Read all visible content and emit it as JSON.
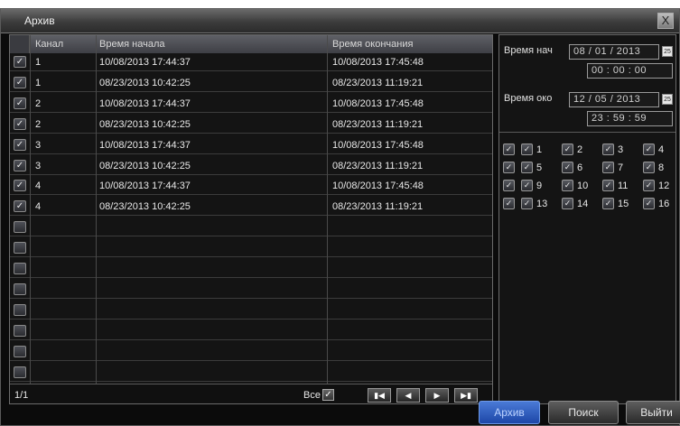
{
  "window": {
    "title": "Архив",
    "close_glyph": "X"
  },
  "table": {
    "headers": [
      "Канал",
      "Время начала",
      "Время окончания"
    ],
    "rows": [
      {
        "checked": true,
        "channel": "1",
        "start": "10/08/2013 17:44:37",
        "end": "10/08/2013 17:45:48"
      },
      {
        "checked": true,
        "channel": "1",
        "start": "08/23/2013 10:42:25",
        "end": "08/23/2013 11:19:21"
      },
      {
        "checked": true,
        "channel": "2",
        "start": "10/08/2013 17:44:37",
        "end": "10/08/2013 17:45:48"
      },
      {
        "checked": true,
        "channel": "2",
        "start": "08/23/2013 10:42:25",
        "end": "08/23/2013 11:19:21"
      },
      {
        "checked": true,
        "channel": "3",
        "start": "10/08/2013 17:44:37",
        "end": "10/08/2013 17:45:48"
      },
      {
        "checked": true,
        "channel": "3",
        "start": "08/23/2013 10:42:25",
        "end": "08/23/2013 11:19:21"
      },
      {
        "checked": true,
        "channel": "4",
        "start": "10/08/2013 17:44:37",
        "end": "10/08/2013 17:45:48"
      },
      {
        "checked": true,
        "channel": "4",
        "start": "08/23/2013 10:42:25",
        "end": "08/23/2013 11:19:21"
      },
      {
        "checked": false,
        "channel": "",
        "start": "",
        "end": ""
      },
      {
        "checked": false,
        "channel": "",
        "start": "",
        "end": ""
      },
      {
        "checked": false,
        "channel": "",
        "start": "",
        "end": ""
      },
      {
        "checked": false,
        "channel": "",
        "start": "",
        "end": ""
      },
      {
        "checked": false,
        "channel": "",
        "start": "",
        "end": ""
      },
      {
        "checked": false,
        "channel": "",
        "start": "",
        "end": ""
      },
      {
        "checked": false,
        "channel": "",
        "start": "",
        "end": ""
      },
      {
        "checked": false,
        "channel": "",
        "start": "",
        "end": ""
      }
    ],
    "page": "1/1",
    "all_label": "Все",
    "all_checked": true,
    "nav": [
      "first-page-icon",
      "prev-page-icon",
      "next-page-icon",
      "last-page-icon"
    ]
  },
  "search": {
    "start_label": "Время нач",
    "start_date": "08 / 01 / 2013",
    "start_time": "00  :  00  :  00",
    "end_label": "Время око",
    "end_date": "12 / 05 / 2013",
    "end_time": "23  :  59  :  59",
    "calendar_icon_text": "25",
    "channels": [
      [
        "1",
        "2",
        "3",
        "4"
      ],
      [
        "5",
        "6",
        "7",
        "8"
      ],
      [
        "9",
        "10",
        "11",
        "12"
      ],
      [
        "13",
        "14",
        "15",
        "16"
      ]
    ]
  },
  "buttons": {
    "archive": "Архив",
    "search": "Поиск",
    "exit": "Выйти"
  },
  "colors": {
    "accent": "#2a5cc4",
    "background": "#0b0b0b",
    "header": "#4a4b51"
  }
}
